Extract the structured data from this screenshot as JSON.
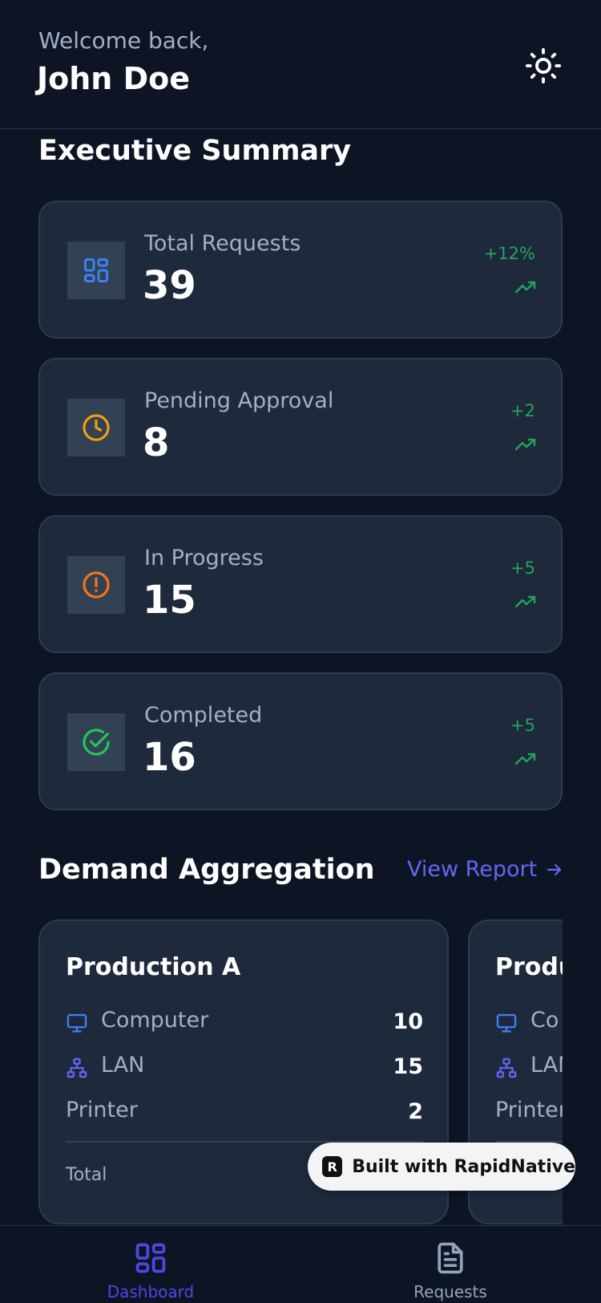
{
  "header": {
    "greeting": "Welcome back,",
    "user_name": "John Doe",
    "theme_icon": "sun-icon"
  },
  "summary": {
    "title": "Executive Summary",
    "cards": [
      {
        "label": "Total Requests",
        "value": "39",
        "delta": "+12%",
        "icon": "grid-icon",
        "icon_color": "#3b82f6"
      },
      {
        "label": "Pending Approval",
        "value": "8",
        "delta": "+2",
        "icon": "clock-icon",
        "icon_color": "#f59e0b"
      },
      {
        "label": "In Progress",
        "value": "15",
        "delta": "+5",
        "icon": "alert-circle-icon",
        "icon_color": "#f97316"
      },
      {
        "label": "Completed",
        "value": "16",
        "delta": "+5",
        "icon": "check-circle-icon",
        "icon_color": "#22c55e"
      }
    ]
  },
  "demand": {
    "title": "Demand Aggregation",
    "view_report": "View Report",
    "cards": [
      {
        "title": "Production A",
        "rows": [
          {
            "label": "Computer",
            "value": "10",
            "icon": "monitor-icon"
          },
          {
            "label": "LAN",
            "value": "15",
            "icon": "network-icon"
          },
          {
            "label": "Printer",
            "value": "2"
          }
        ],
        "total_label": "Total"
      },
      {
        "title": "Produ",
        "rows": [
          {
            "label": "Co",
            "icon": "monitor-icon"
          },
          {
            "label": "LAN",
            "icon": "network-icon"
          },
          {
            "label": "Printer"
          }
        ]
      }
    ]
  },
  "badge": {
    "text": "Built with RapidNative",
    "logo_letter": "R"
  },
  "nav": {
    "items": [
      {
        "label": "Dashboard",
        "icon": "dashboard-icon",
        "active": true
      },
      {
        "label": "Requests",
        "icon": "document-icon",
        "active": false
      }
    ]
  },
  "colors": {
    "background": "#0d1525",
    "card": "#1e293b",
    "accent": "#6366f1",
    "positive": "#22a55a"
  }
}
